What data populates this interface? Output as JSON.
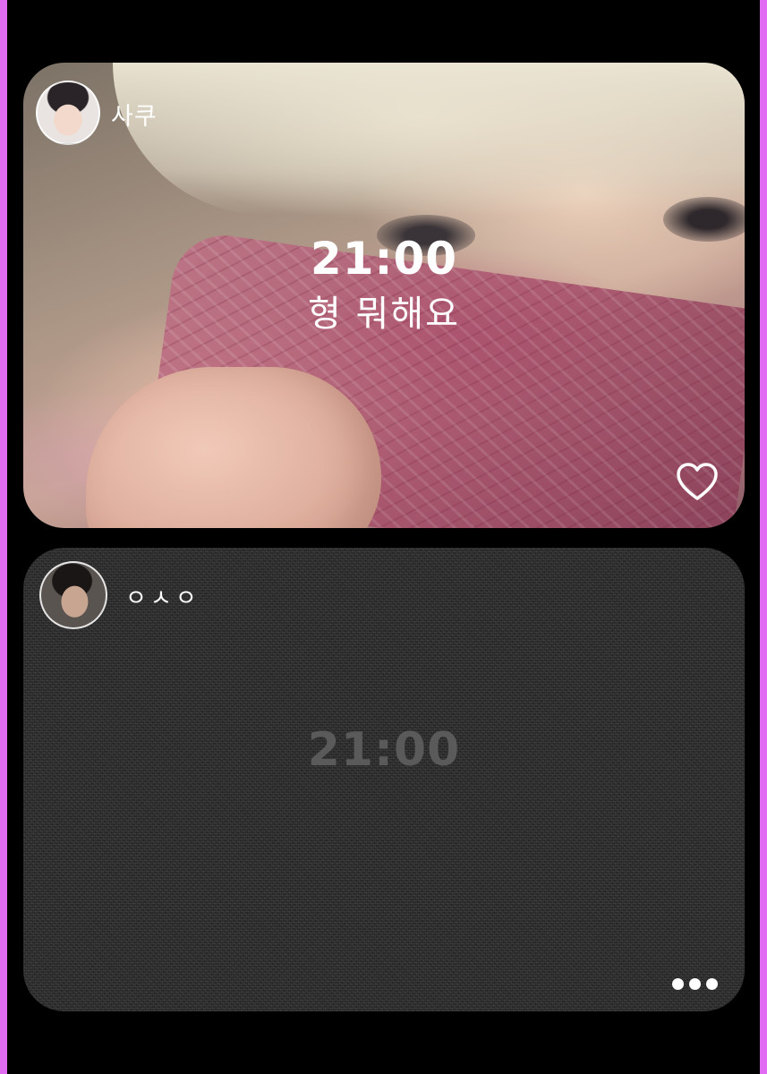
{
  "colors": {
    "side_edge": "#e06cf2",
    "background": "#000000",
    "noise_card": "#2f2f2f"
  },
  "cards": [
    {
      "username": "사쿠",
      "time": "21:00",
      "caption": "형 뭐해요",
      "action_icon": "heart-icon"
    },
    {
      "username": "ㅇㅅㅇ",
      "time": "21:00",
      "action_icon": "more-horizontal-icon"
    }
  ]
}
